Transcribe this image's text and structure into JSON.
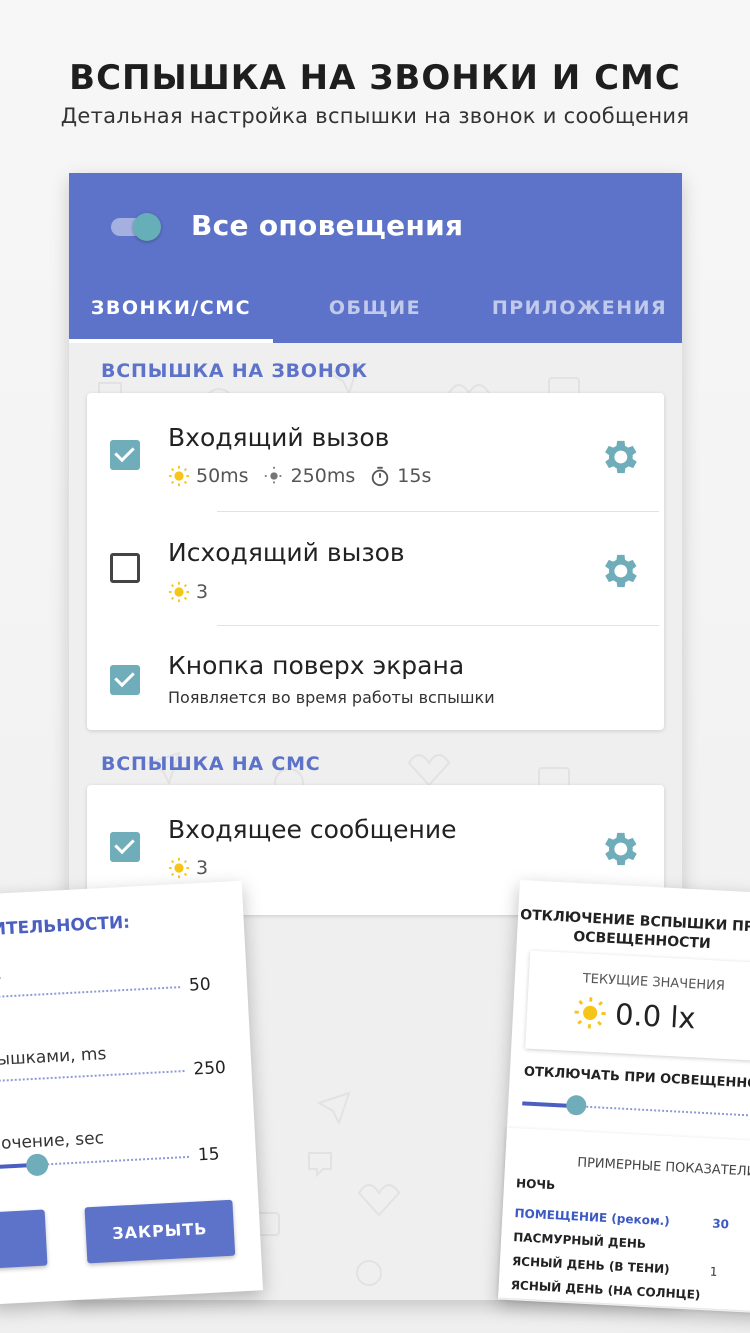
{
  "header": {
    "title": "ВСПЫШКА НА ЗВОНКИ И СМС",
    "subtitle": "Детальная настройка вспышки на звонок и сообщения"
  },
  "appbar": {
    "title": "Все оповещения",
    "toggle_on": true,
    "color": "#5d73c9",
    "tabs": [
      {
        "label": "ЗВОНКИ/СМС",
        "active": true
      },
      {
        "label": "ОБЩИЕ",
        "active": false
      },
      {
        "label": "ПРИЛОЖЕНИЯ",
        "active": false
      }
    ]
  },
  "calls": {
    "label": "ВСПЫШКА НА ЗВОНОК",
    "items": [
      {
        "title": "Входящий вызов",
        "checked": true,
        "on_time": "50ms",
        "off_time": "250ms",
        "duration": "15s",
        "icons": [
          "sun-icon",
          "dim-sun-icon",
          "timer-icon",
          "gear-icon"
        ]
      },
      {
        "title": "Исходящий вызов",
        "checked": false,
        "count": "3",
        "icons": [
          "sun-icon",
          "gear-icon"
        ]
      },
      {
        "title": "Кнопка поверх экрана",
        "checked": true,
        "description": "Появляется во время работы вспышки"
      }
    ]
  },
  "sms": {
    "label": "ВСПЫШКА НА СМС",
    "items": [
      {
        "title": "Входящее сообщение",
        "checked": true,
        "count": "3",
        "icons": [
          "sun-icon",
          "gear-icon"
        ]
      }
    ]
  },
  "dialog_left": {
    "title": "ИТЕЛЬНОСТИ:",
    "rows": [
      {
        "label": "s",
        "value": "50",
        "level": 1.0
      },
      {
        "label": "ышками, ms",
        "value": "250",
        "level": 1.0
      },
      {
        "label": "очение, sec",
        "value": "15",
        "level": 0.25
      }
    ],
    "close_label": "ЗАКРЫТЬ"
  },
  "dialog_right": {
    "title_line1": "ОТКЛЮЧЕНИЕ ВСПЫШКИ ПРИ",
    "title_line2": "ОСВЕЩЕННОСТИ",
    "current_label": "ТЕКУЩИЕ ЗНАЧЕНИЯ",
    "lux": "0.0 lx",
    "off_label": "ОТКЛЮЧАТЬ ПРИ ОСВЕЩЕННОСТИ",
    "slider_level": 0.22,
    "examples_label": "ПРИМЕРНЫЕ ПОКАЗАТЕЛИ",
    "examples": [
      {
        "name": "НОЧЬ",
        "value": ""
      },
      {
        "name": "ПОМЕЩЕНИЕ (реком.)",
        "value": "30",
        "highlight": true
      },
      {
        "name": "ПАСМУРНЫЙ ДЕНЬ",
        "value": ""
      },
      {
        "name": "ЯСНЫЙ ДЕНЬ (В ТЕНИ)",
        "value": "1"
      },
      {
        "name": "ЯСНЫЙ ДЕНЬ (НА СОЛНЦЕ)",
        "value": ""
      }
    ]
  }
}
